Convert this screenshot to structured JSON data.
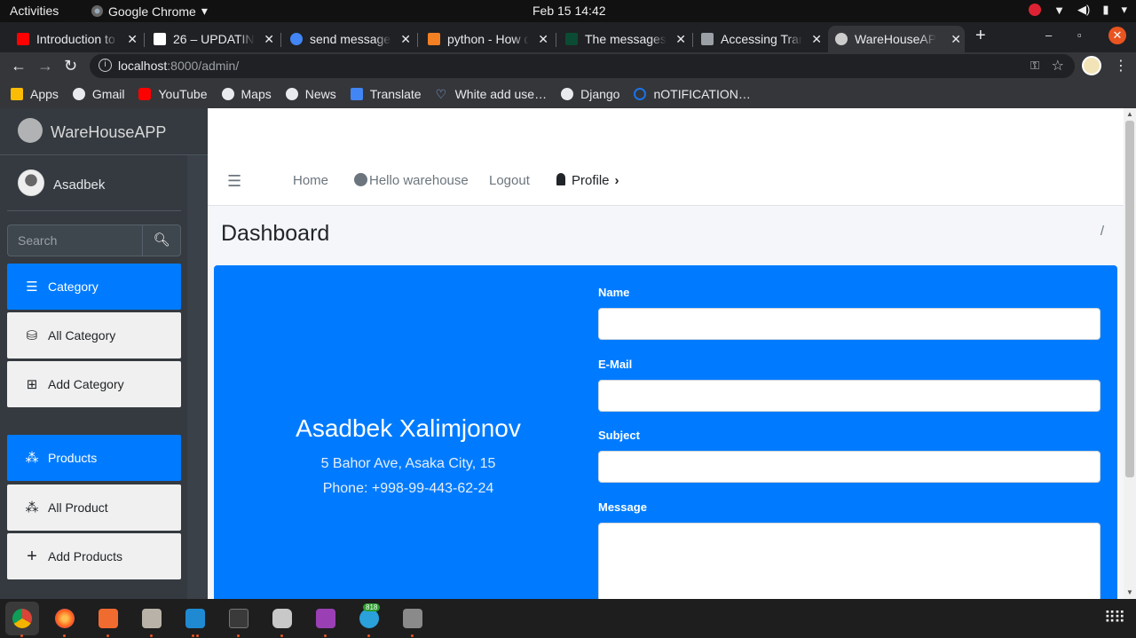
{
  "system": {
    "activities": "Activities",
    "app_menu": "Google Chrome",
    "clock": "Feb 15  14:42"
  },
  "browser": {
    "tabs": [
      {
        "title": "Introduction to",
        "favicon_color": "#ff0000"
      },
      {
        "title": "26 – UPDATING",
        "favicon_color": "#ffffff"
      },
      {
        "title": "send message",
        "favicon_color": "#4285f4"
      },
      {
        "title": "python - How d",
        "favicon_color": "#f48024"
      },
      {
        "title": "The messages",
        "favicon_color": "#0c4b33"
      },
      {
        "title": "Accessing Trar",
        "favicon_color": "#9aa0a6"
      },
      {
        "title": "WareHouseAP",
        "favicon_color": "#cccccc"
      }
    ],
    "url_host": "localhost",
    "url_path": ":8000/admin/",
    "bookmarks": [
      {
        "label": "Apps",
        "icon": "apps-grid-icon",
        "color": "#fbbc05"
      },
      {
        "label": "Gmail",
        "icon": "globe-icon",
        "color": "#e8eaed"
      },
      {
        "label": "YouTube",
        "icon": "youtube-icon",
        "color": "#ff0000"
      },
      {
        "label": "Maps",
        "icon": "globe-icon",
        "color": "#e8eaed"
      },
      {
        "label": "News",
        "icon": "globe-icon",
        "color": "#e8eaed"
      },
      {
        "label": "Translate",
        "icon": "translate-icon",
        "color": "#4285f4"
      },
      {
        "label": "White add use…",
        "icon": "heart-icon",
        "color": "#8ab4f8"
      },
      {
        "label": "Django",
        "icon": "globe-icon",
        "color": "#e8eaed"
      },
      {
        "label": "nOTIFICATION…",
        "icon": "refresh-icon",
        "color": "#1a73e8"
      }
    ]
  },
  "app": {
    "brand": "WareHouseAPP",
    "user": "Asadbek",
    "search_placeholder": "Search",
    "sidebar": {
      "category": "Category",
      "all_category": "All Category",
      "add_category": "Add Category",
      "products": "Products",
      "all_product": "All Product",
      "add_products": "Add Products"
    },
    "topnav": {
      "home": "Home",
      "hello": "Hello warehouse",
      "logout": "Logout",
      "profile": "Profile"
    },
    "page_title": "Dashboard",
    "breadcrumb": "/",
    "contact": {
      "name": "Asadbek Xalimjonov",
      "address": "5 Bahor Ave, Asaka City, 15",
      "phone": "Phone: +998-99-443-62-24"
    },
    "form": {
      "name_label": "Name",
      "email_label": "E-Mail",
      "subject_label": "Subject",
      "message_label": "Message"
    },
    "colors": {
      "primary": "#007bff",
      "sidebar": "#343a40"
    }
  },
  "dock": {
    "telegram_badge": "818"
  }
}
